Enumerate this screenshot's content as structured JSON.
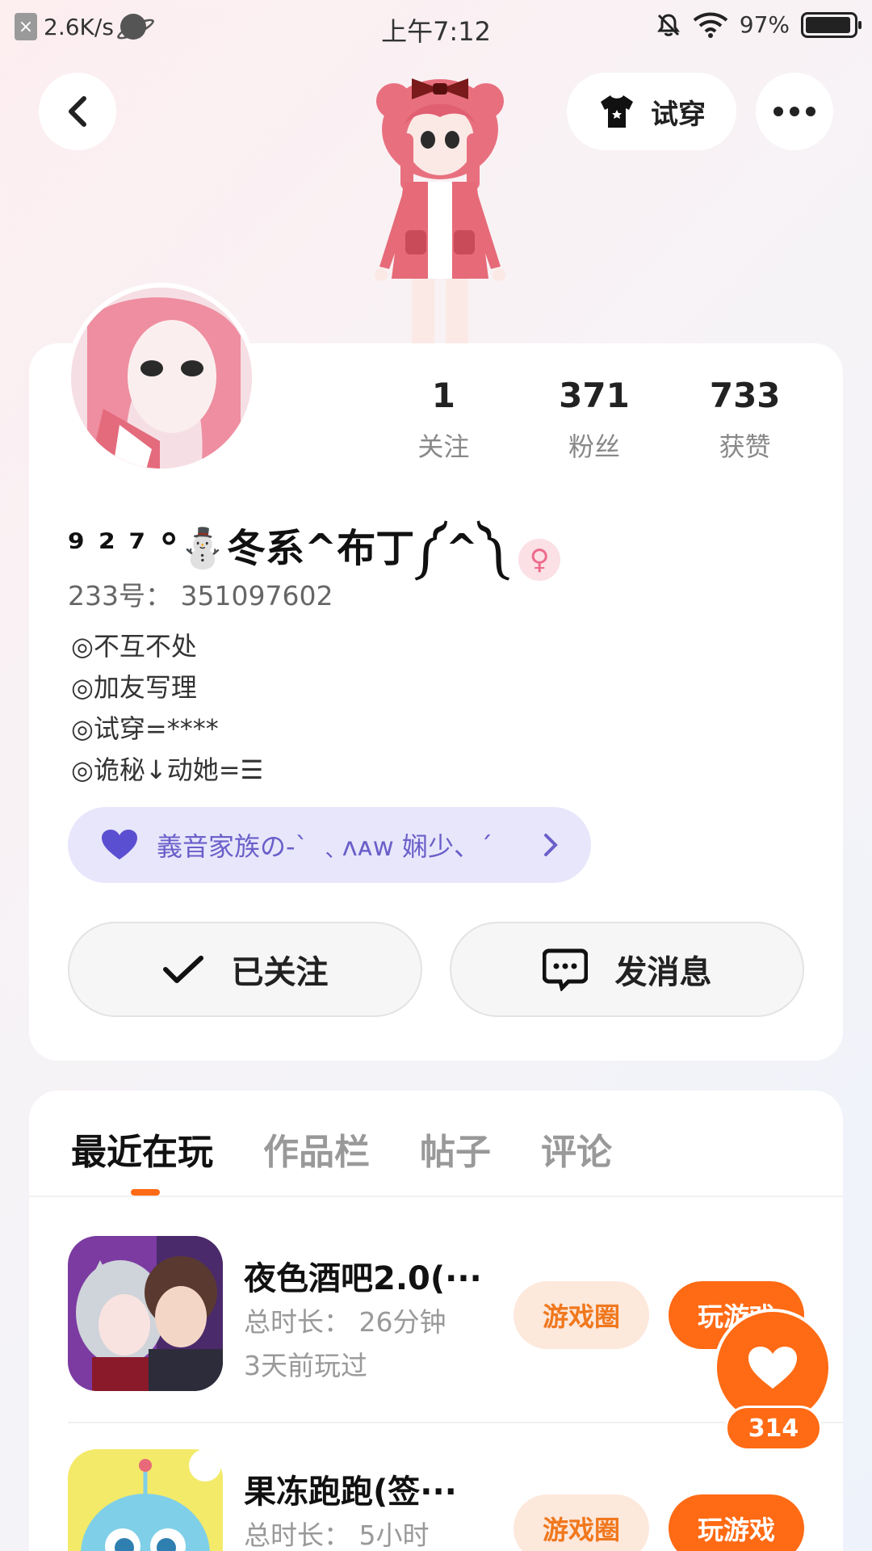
{
  "status_bar": {
    "net_speed": "2.6K/s",
    "time": "上午7:12",
    "battery": "97%"
  },
  "header": {
    "tryon_label": "试穿"
  },
  "profile": {
    "stats": [
      {
        "value": "1",
        "label": "关注"
      },
      {
        "value": "371",
        "label": "粉丝"
      },
      {
        "value": "733",
        "label": "获赞"
      }
    ],
    "nickname": "⁹ ² ⁷ °⛄冬系^布丁༼^༽",
    "gender_symbol": "♀",
    "uid": "233号： 351097602",
    "bio": [
      "◎不互不处",
      "◎加友写理",
      "◎试穿=****",
      "◎诡秘↓动她=☰"
    ],
    "family": "義音家族の-` ﹑ʌᴀᴡ 娴少、´",
    "follow_label": "已关注",
    "message_label": "发消息"
  },
  "tabs": [
    "最近在玩",
    "作品栏",
    "帖子",
    "评论"
  ],
  "games": [
    {
      "title": "夜色酒吧2.0(···",
      "duration": "总时长： 26分钟",
      "last_played": "3天前玩过",
      "circle_label": "游戏圈",
      "play_label": "玩游戏"
    },
    {
      "title": "果冻跑跑(签···",
      "duration": "总时长： 5小时",
      "circle_label": "游戏圈",
      "play_label": "玩游戏"
    }
  ],
  "like": {
    "count": "314"
  },
  "colors": {
    "accent": "#ff6a14",
    "family_bg": "#e8e6fb",
    "family_text": "#6a5fc9"
  }
}
